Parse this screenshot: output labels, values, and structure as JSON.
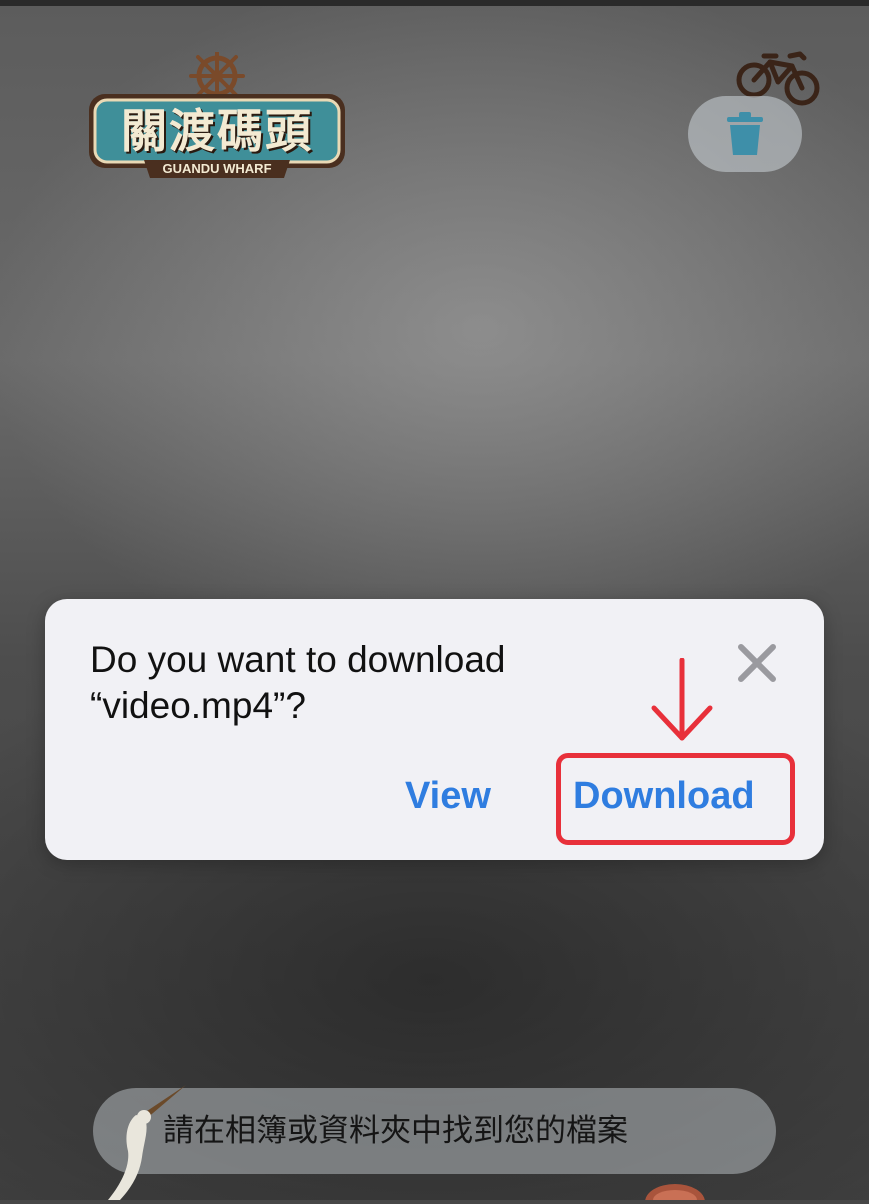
{
  "header": {
    "logo": {
      "title_text": "關渡碼頭",
      "subtitle_text": "GUANDU WHARF",
      "icon": "ship-wheel-icon"
    },
    "bike_icon": "bicycle-icon",
    "trash_icon": "trash-icon"
  },
  "dialog": {
    "title_line1": "Do you want to download",
    "title_line2": "“video.mp4”?",
    "close_icon": "close-icon",
    "view_label": "View",
    "download_label": "Download"
  },
  "annotation": {
    "color": "#e8303a",
    "arrow_icon": "arrow-down-icon"
  },
  "toast": {
    "text": "請在相簿或資料夾中找到您的檔案"
  },
  "colors": {
    "accent_blue": "#2f7de0",
    "dialog_bg": "#f1f1f5",
    "logo_teal": "#3f8f99",
    "logo_brown": "#4a2f1f"
  }
}
